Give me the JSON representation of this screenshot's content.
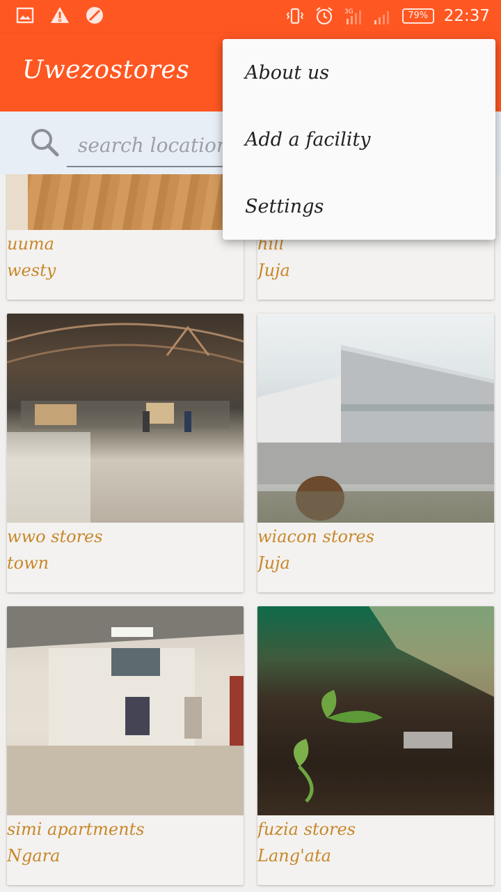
{
  "status_bar": {
    "battery": "79%",
    "time": "22:37",
    "network": "3G"
  },
  "app_bar": {
    "title": "Uwezostores"
  },
  "search": {
    "placeholder": "search location"
  },
  "cards": [
    {
      "name": "uuma",
      "location": "westy"
    },
    {
      "name": "hill",
      "location": "Juja"
    },
    {
      "name": "wwo stores",
      "location": "town"
    },
    {
      "name": "wiacon stores",
      "location": "Juja"
    },
    {
      "name": "simi apartments",
      "location": "Ngara"
    },
    {
      "name": "fuzia stores",
      "location": "Lang'ata"
    }
  ],
  "menu": {
    "items": [
      "About us",
      "Add a facility",
      "Settings"
    ]
  },
  "colors": {
    "accent": "#ff5722",
    "text_gold": "#c8872a"
  }
}
